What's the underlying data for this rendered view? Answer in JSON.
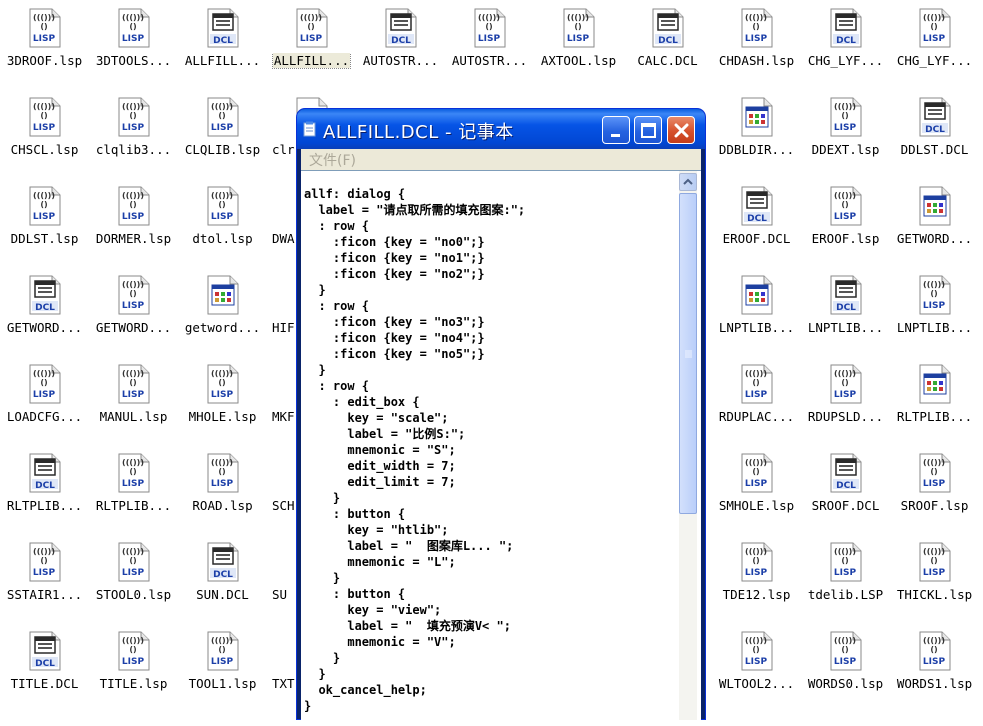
{
  "desktop": {
    "rows": [
      [
        {
          "name": "3DROOF.lsp",
          "type": "lisp"
        },
        {
          "name": "3DTOOLS...",
          "type": "lisp"
        },
        {
          "name": "ALLFILL...",
          "type": "dcl"
        },
        {
          "name": "ALLFILL...",
          "type": "lisp",
          "selected": true
        },
        {
          "name": "AUTOSTR...",
          "type": "dcl"
        },
        {
          "name": "AUTOSTR...",
          "type": "lisp"
        },
        {
          "name": "AXTOOL.lsp",
          "type": "lisp"
        },
        {
          "name": "CALC.DCL",
          "type": "dcl"
        },
        {
          "name": "CHDASH.lsp",
          "type": "lisp"
        },
        {
          "name": "CHG_LYF...",
          "type": "dcl"
        },
        {
          "name": "CHG_LYF...",
          "type": "lisp"
        }
      ],
      [
        {
          "name": "CHSCL.lsp",
          "type": "lisp"
        },
        {
          "name": "clqlib3...",
          "type": "lisp"
        },
        {
          "name": "CLQLIB.lsp",
          "type": "lisp"
        },
        {
          "name": "clr",
          "type": "generic"
        },
        null,
        null,
        null,
        null,
        {
          "name": "DDBLDIR...",
          "type": "app"
        },
        {
          "name": "DDEXT.lsp",
          "type": "lisp"
        },
        {
          "name": "DDLST.DCL",
          "type": "dcl"
        }
      ],
      [
        {
          "name": "DDLST.lsp",
          "type": "lisp"
        },
        {
          "name": "DORMER.lsp",
          "type": "lisp"
        },
        {
          "name": "dtol.lsp",
          "type": "lisp"
        },
        {
          "name": "DWA",
          "type": "none"
        },
        null,
        null,
        null,
        null,
        {
          "name": "EROOF.DCL",
          "type": "dcl"
        },
        {
          "name": "EROOF.lsp",
          "type": "lisp"
        },
        {
          "name": "GETWORD...",
          "type": "app"
        }
      ],
      [
        {
          "name": "GETWORD...",
          "type": "dcl"
        },
        {
          "name": "GETWORD...",
          "type": "lisp"
        },
        {
          "name": "getword...",
          "type": "app"
        },
        {
          "name": "HIF",
          "type": "none"
        },
        null,
        null,
        null,
        null,
        {
          "name": "LNPTLIB...",
          "type": "app"
        },
        {
          "name": "LNPTLIB...",
          "type": "dcl"
        },
        {
          "name": "LNPTLIB...",
          "type": "lisp"
        }
      ],
      [
        {
          "name": "LOADCFG...",
          "type": "lisp"
        },
        {
          "name": "MANUL.lsp",
          "type": "lisp"
        },
        {
          "name": "MHOLE.lsp",
          "type": "lisp"
        },
        {
          "name": "MKF",
          "type": "none"
        },
        null,
        null,
        null,
        null,
        {
          "name": "RDUPLAC...",
          "type": "lisp"
        },
        {
          "name": "RDUPSLD...",
          "type": "lisp"
        },
        {
          "name": "RLTPLIB...",
          "type": "app"
        }
      ],
      [
        {
          "name": "RLTPLIB...",
          "type": "dcl"
        },
        {
          "name": "RLTPLIB...",
          "type": "lisp"
        },
        {
          "name": "ROAD.lsp",
          "type": "lisp"
        },
        {
          "name": "SCH",
          "type": "none"
        },
        null,
        null,
        null,
        null,
        {
          "name": "SMHOLE.lsp",
          "type": "lisp"
        },
        {
          "name": "SROOF.DCL",
          "type": "dcl"
        },
        {
          "name": "SROOF.lsp",
          "type": "lisp"
        }
      ],
      [
        {
          "name": "SSTAIR1...",
          "type": "lisp"
        },
        {
          "name": "STOOL0.lsp",
          "type": "lisp"
        },
        {
          "name": "SUN.DCL",
          "type": "dcl"
        },
        {
          "name": "SU",
          "type": "none"
        },
        null,
        null,
        null,
        null,
        {
          "name": "TDE12.lsp",
          "type": "lisp"
        },
        {
          "name": "tdelib.LSP",
          "type": "lisp"
        },
        {
          "name": "THICKL.lsp",
          "type": "lisp"
        }
      ],
      [
        {
          "name": "TITLE.DCL",
          "type": "dcl"
        },
        {
          "name": "TITLE.lsp",
          "type": "lisp"
        },
        {
          "name": "TOOL1.lsp",
          "type": "lisp"
        },
        {
          "name": "TXT",
          "type": "none"
        },
        null,
        null,
        null,
        null,
        {
          "name": "WLTOOL2...",
          "type": "lisp"
        },
        {
          "name": "WORDS0.lsp",
          "type": "lisp"
        },
        {
          "name": "WORDS1.lsp",
          "type": "lisp"
        }
      ]
    ],
    "icon_labels": {
      "lisp": "LISP",
      "dcl": "DCL"
    }
  },
  "notepad": {
    "title": "ALLFILL.DCL - 记事本",
    "menu_file": "文件(F)",
    "content": "allf: dialog {\n  label = \"请点取所需的填充图案:\";\n  : row {\n    :ficon {key = \"no0\";}\n    :ficon {key = \"no1\";}\n    :ficon {key = \"no2\";}\n  }\n  : row {\n    :ficon {key = \"no3\";}\n    :ficon {key = \"no4\";}\n    :ficon {key = \"no5\";}\n  }\n  : row {\n    : edit_box {\n      key = \"scale\";\n      label = \"比例S:\";\n      mnemonic = \"S\";\n      edit_width = 7;\n      edit_limit = 7;\n    }\n    : button {\n      key = \"htlib\";\n      label = \"  图案库L... \";\n      mnemonic = \"L\";\n    }\n    : button {\n      key = \"view\";\n      label = \"  填充预演V< \";\n      mnemonic = \"V\";\n    }\n  }\n  ok_cancel_help;\n}"
  },
  "colors": {
    "title_bar": "#0654e6",
    "close_button": "#d6512c",
    "lisp_text": "#1c3fa8",
    "dcl_text": "#1c3fa8"
  }
}
